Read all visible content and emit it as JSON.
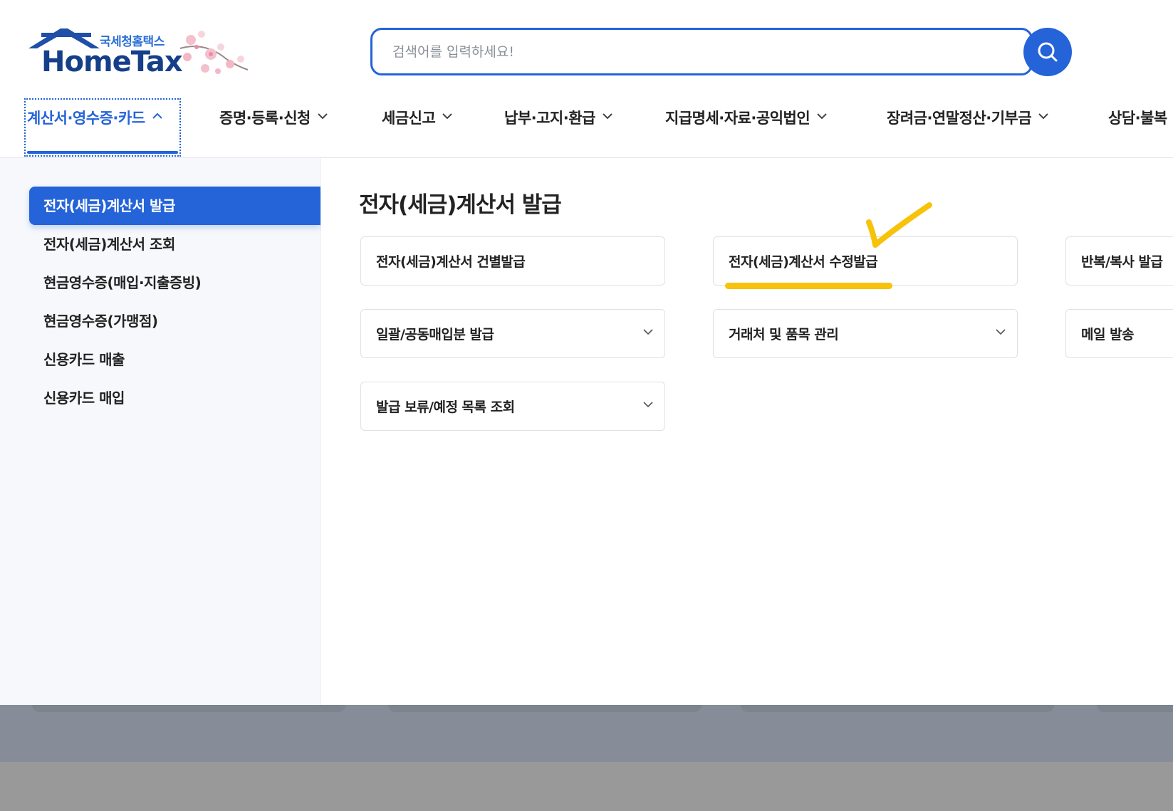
{
  "header": {
    "logo_sub": "국세청홈택스",
    "logo_main": "HomeTax",
    "search_placeholder": "검색어를 입력하세요!"
  },
  "gnb": [
    {
      "label": "계산서·영수증·카드",
      "active": true
    },
    {
      "label": "증명·등록·신청"
    },
    {
      "label": "세금신고"
    },
    {
      "label": "납부·고지·환급"
    },
    {
      "label": "지급명세·자료·공익법인"
    },
    {
      "label": "장려금·연말정산·기부금"
    },
    {
      "label": "상담·불복"
    }
  ],
  "sidebar": {
    "items": [
      {
        "label": "전자(세금)계산서 발급",
        "active": true
      },
      {
        "label": "전자(세금)계산서 조회"
      },
      {
        "label": "현금영수증(매입·지출증빙)"
      },
      {
        "label": "현금영수증(가맹점)"
      },
      {
        "label": "신용카드 매출"
      },
      {
        "label": "신용카드 매입"
      }
    ]
  },
  "content": {
    "title": "전자(세금)계산서 발급",
    "cards": [
      {
        "label": "전자(세금)계산서 건별발급"
      },
      {
        "label": "전자(세금)계산서 수정발급"
      },
      {
        "label": "반복/복사 발급"
      },
      {
        "label": "일괄/공동매입분 발급",
        "expandable": true
      },
      {
        "label": "거래처 및 품목 관리",
        "expandable": true
      },
      {
        "label": "메일 발송"
      },
      {
        "label": "발급 보류/예정 목록 조회",
        "expandable": true
      }
    ]
  },
  "colors": {
    "accent": "#2563d9",
    "annotation": "#f7c20a",
    "sidebar_bg": "#f6f8fb"
  }
}
